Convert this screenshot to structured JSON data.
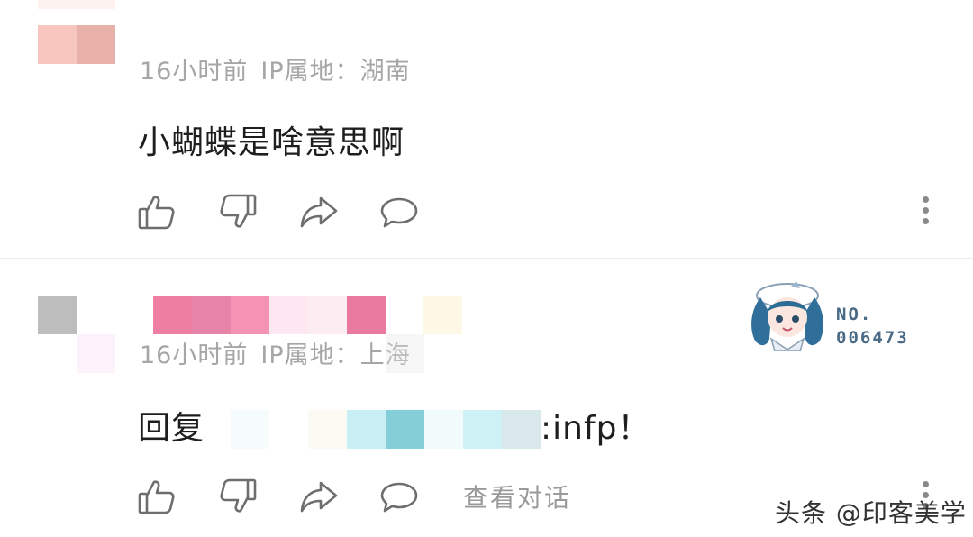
{
  "comments": [
    {
      "time": "16小时前",
      "ip_label": "IP属地：",
      "ip_location": "湖南",
      "text": "小蝴蝶是啥意思啊"
    },
    {
      "time": "16小时前",
      "ip_label": "IP属地：",
      "ip_location": "上海",
      "reply_prefix": "回复",
      "reply_suffix": ":infp！",
      "badge": {
        "line1": "NO.",
        "line2": "006473"
      },
      "view_conversation": "查看对话"
    }
  ],
  "watermark": "头条 @印客美学",
  "colors": {
    "meta_text": "#a6a6a6",
    "icon_stroke": "#6e6e6e",
    "badge_text": "#4a6a86"
  }
}
